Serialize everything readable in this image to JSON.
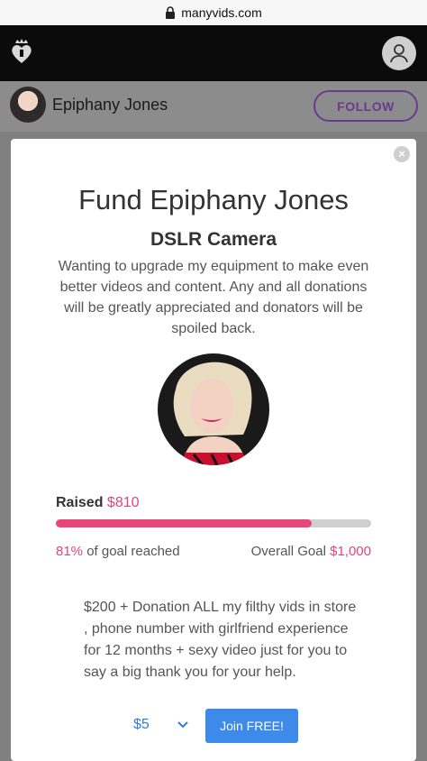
{
  "browser": {
    "url": "manyvids.com",
    "lock_icon": "lock-icon"
  },
  "header": {
    "logo_icon": "heart-crown-logo",
    "account_icon": "user-icon"
  },
  "profile": {
    "name": "Epiphany Jones",
    "follow_label": "FOLLOW"
  },
  "modal": {
    "title": "Fund Epiphany Jones",
    "subtitle": "DSLR Camera",
    "description": "Wanting to upgrade my equipment to make even better videos and content. Any and all donations will be greatly appreciated and donators will be spoiled back.",
    "raised_label": "Raised",
    "raised_amount": "$810",
    "progress_fraction": 0.81,
    "percent_reached": "81%",
    "reached_suffix": " of goal reached",
    "goal_label": "Overall Goal ",
    "goal_amount": "$1,000",
    "reward_text": "$200 + Donation ALL my filthy vids in store , phone number with girlfriend experience for 12 months + sexy video just for you to say a big thank you for your help.",
    "donation_amount": "$5",
    "join_label": "Join FREE!",
    "close_symbol": "×"
  },
  "colors": {
    "accent_pink": "#e8457b",
    "follow_purple": "#6a3a8f",
    "button_blue": "#3d8ae8"
  }
}
